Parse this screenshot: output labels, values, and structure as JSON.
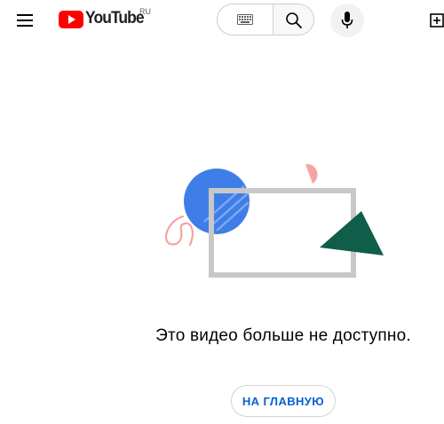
{
  "header": {
    "logo_text": "YouTube",
    "region": "RU",
    "search": {
      "keyboard_icon": "keyboard-icon",
      "search_icon": "search-icon"
    },
    "mic_icon": "mic-icon",
    "create_icon": "create-video-icon"
  },
  "main": {
    "message": "Это видео больше не доступно.",
    "home_button_label": "НА ГЛАВНУЮ"
  },
  "colors": {
    "brand_red": "#ff0000",
    "link_blue": "#065fd4",
    "circle_blue": "#3f7ee8",
    "triangle_green": "#0f5e4a",
    "accent_pink": "#f5a3a3"
  }
}
